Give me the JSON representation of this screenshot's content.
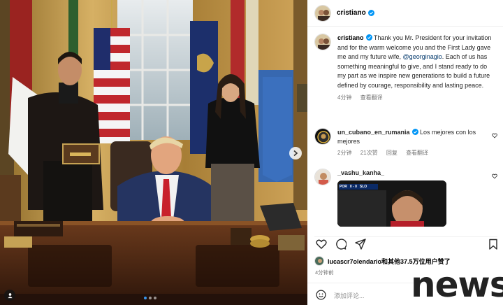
{
  "post": {
    "username": "cristiano",
    "verified": true,
    "image_caption_alt": "",
    "carousel": {
      "current": 1,
      "total": 3
    }
  },
  "caption": {
    "username": "cristiano",
    "text_before": " Thank you Mr. President for your invitation and for the warm welcome you and the First Lady gave me and my future wife, ",
    "mention": "@georginagio",
    "text_after": ". Each of us has something meaningful to give, and I stand ready to do my part as we inspire new generations to build a future defined by courage, responsibility and lasting peace.",
    "time": "4分钟",
    "translate": "查看翻译"
  },
  "comments": [
    {
      "username": "un_cubano_en_rumania",
      "verified": true,
      "text": "Los mejores con los mejores",
      "time": "2分钟",
      "likes": "21次赞",
      "reply": "回复",
      "translate": "查看翻译"
    },
    {
      "username": "_vashu_kanha_",
      "verified": false,
      "text": ""
    }
  ],
  "thumb_score": {
    "left": "POR",
    "score": "0 - 0",
    "right": "SLO"
  },
  "likes_line": {
    "username": "lucascr7olendario",
    "rest": "和其他37.5万位用户赞了"
  },
  "post_time": "4分钟前",
  "add_comment_placeholder": "添加评论...",
  "watermark": "news",
  "icons": [
    "heart-icon",
    "comment-icon",
    "share-icon",
    "bookmark-icon",
    "emoji-icon",
    "verified-icon",
    "next-arrow-icon",
    "tag-user-icon"
  ],
  "colors": {
    "verified": "#0095f6",
    "mention": "#00376b",
    "muted": "#737373"
  }
}
